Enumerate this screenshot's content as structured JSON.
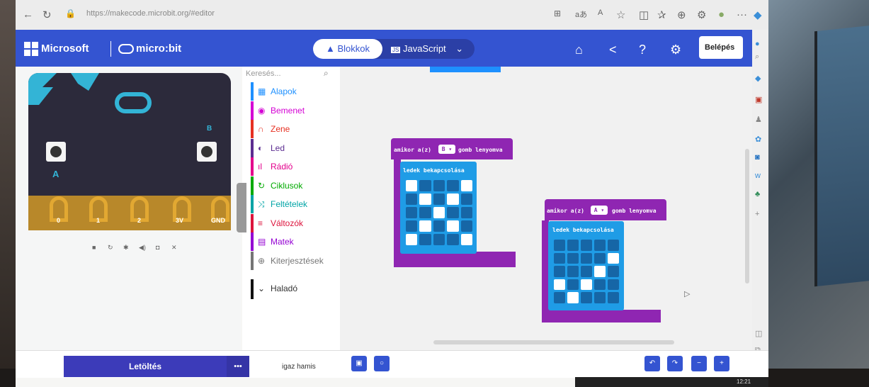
{
  "browser": {
    "url": "https://makecode.microbit.org/#editor"
  },
  "header": {
    "brand": "Microsoft",
    "product": "micro:bit",
    "tabs": {
      "blocks": "Blokkok",
      "javascript": "JavaScript"
    },
    "login": "Belépés"
  },
  "simulator": {
    "pins": [
      "0",
      "1",
      "2",
      "3V",
      "GND"
    ],
    "button_a": "A",
    "button_b": "B"
  },
  "toolbox": {
    "search_placeholder": "Keresés...",
    "categories": [
      {
        "label": "Alapok",
        "color": "#1e90ff",
        "icon": "grid-icon"
      },
      {
        "label": "Bemenet",
        "color": "#d400d4",
        "icon": "circle-icon"
      },
      {
        "label": "Zene",
        "color": "#e63022",
        "icon": "headphones-icon"
      },
      {
        "label": "Led",
        "color": "#5c2d91",
        "icon": "toggle-icon"
      },
      {
        "label": "Rádió",
        "color": "#e3008c",
        "icon": "signal-icon"
      },
      {
        "label": "Ciklusok",
        "color": "#00aa00",
        "icon": "loop-icon"
      },
      {
        "label": "Feltételek",
        "color": "#00a4a6",
        "icon": "shuffle-icon"
      },
      {
        "label": "Változók",
        "color": "#dc143c",
        "icon": "list-icon"
      },
      {
        "label": "Matek",
        "color": "#9400d3",
        "icon": "calculator-icon"
      },
      {
        "label": "Kiterjesztések",
        "color": "#757575",
        "icon": "plus-icon"
      }
    ],
    "advanced": "Haladó"
  },
  "workspace": {
    "blocks": [
      {
        "event_prefix": "amikor a(z)",
        "button": "B",
        "event_suffix": "gomb lenyomva",
        "inner": "ledek bekapcsolása",
        "leds": [
          [
            1,
            0,
            0,
            0,
            1
          ],
          [
            0,
            1,
            0,
            1,
            0
          ],
          [
            0,
            0,
            1,
            0,
            0
          ],
          [
            0,
            1,
            0,
            1,
            0
          ],
          [
            1,
            0,
            0,
            0,
            1
          ]
        ]
      },
      {
        "event_prefix": "amikor a(z)",
        "button": "A",
        "event_suffix": "gomb lenyomva",
        "inner": "ledek bekapcsolása",
        "leds": [
          [
            0,
            0,
            0,
            0,
            0
          ],
          [
            0,
            0,
            0,
            0,
            1
          ],
          [
            0,
            0,
            0,
            1,
            0
          ],
          [
            1,
            0,
            1,
            0,
            0
          ],
          [
            0,
            1,
            0,
            0,
            0
          ]
        ]
      }
    ]
  },
  "footer": {
    "download": "Letöltés",
    "more": "•••",
    "project_name": "igaz hamis"
  },
  "taskbar": {
    "time": "12:21"
  }
}
